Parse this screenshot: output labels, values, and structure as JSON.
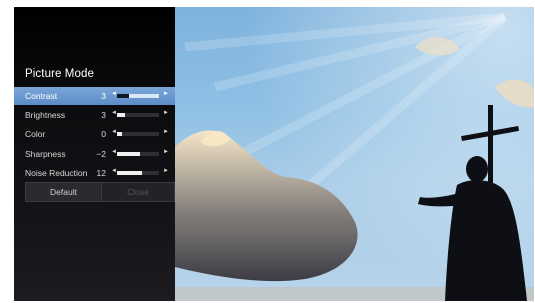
{
  "menu": {
    "title": "Picture Mode",
    "items": [
      {
        "label": "Contrast",
        "value": "3",
        "level": 0.28,
        "selected": true
      },
      {
        "label": "Brightness",
        "value": "3",
        "level": 0.18,
        "selected": false
      },
      {
        "label": "Color",
        "value": "0",
        "level": 0.12,
        "selected": false
      },
      {
        "label": "Sharpness",
        "value": "−2",
        "level": 0.55,
        "selected": false
      },
      {
        "label": "Noise Reduction",
        "value": "12",
        "level": 0.6,
        "selected": false
      }
    ],
    "arrow_left": "◄",
    "arrow_right": "►",
    "buttons": {
      "default": "Default",
      "close": "Close"
    }
  },
  "colors": {
    "selection": "#6d9ad0",
    "panel": "#101014",
    "sky": "#8fc0e4"
  },
  "icons": {
    "slider_left": "triangle-left-icon",
    "slider_right": "triangle-right-icon"
  }
}
